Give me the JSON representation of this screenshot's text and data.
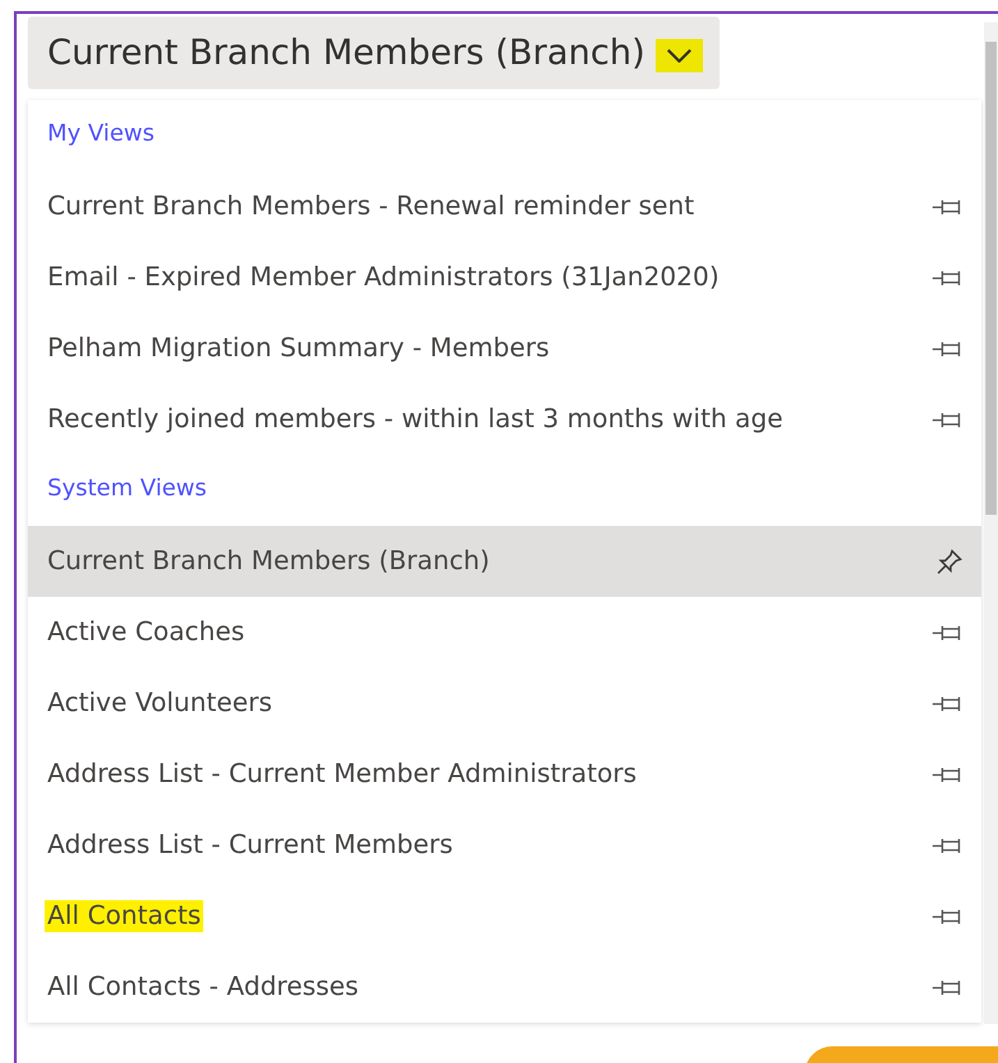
{
  "view_selector": {
    "title": "Current Branch Members (Branch)",
    "expanded": true,
    "chevron_highlighted": true
  },
  "sections": [
    {
      "heading": "My Views",
      "items": [
        {
          "label": "Current Branch Members - Renewal reminder sent",
          "selected": false,
          "pinned": false,
          "highlighted": false
        },
        {
          "label": "Email - Expired Member Administrators (31Jan2020)",
          "selected": false,
          "pinned": false,
          "highlighted": false
        },
        {
          "label": "Pelham Migration Summary - Members",
          "selected": false,
          "pinned": false,
          "highlighted": false
        },
        {
          "label": "Recently joined members - within last 3 months with age",
          "selected": false,
          "pinned": false,
          "highlighted": false
        }
      ]
    },
    {
      "heading": "System Views",
      "items": [
        {
          "label": "Current Branch Members (Branch)",
          "selected": true,
          "pinned": true,
          "highlighted": false
        },
        {
          "label": "Active Coaches",
          "selected": false,
          "pinned": false,
          "highlighted": false
        },
        {
          "label": "Active Volunteers",
          "selected": false,
          "pinned": false,
          "highlighted": false
        },
        {
          "label": "Address List - Current Member Administrators",
          "selected": false,
          "pinned": false,
          "highlighted": false
        },
        {
          "label": "Address List - Current Members",
          "selected": false,
          "pinned": false,
          "highlighted": false
        },
        {
          "label": "All Contacts",
          "selected": false,
          "pinned": false,
          "highlighted": true
        },
        {
          "label": "All Contacts - Addresses",
          "selected": false,
          "pinned": false,
          "highlighted": false
        }
      ]
    }
  ]
}
